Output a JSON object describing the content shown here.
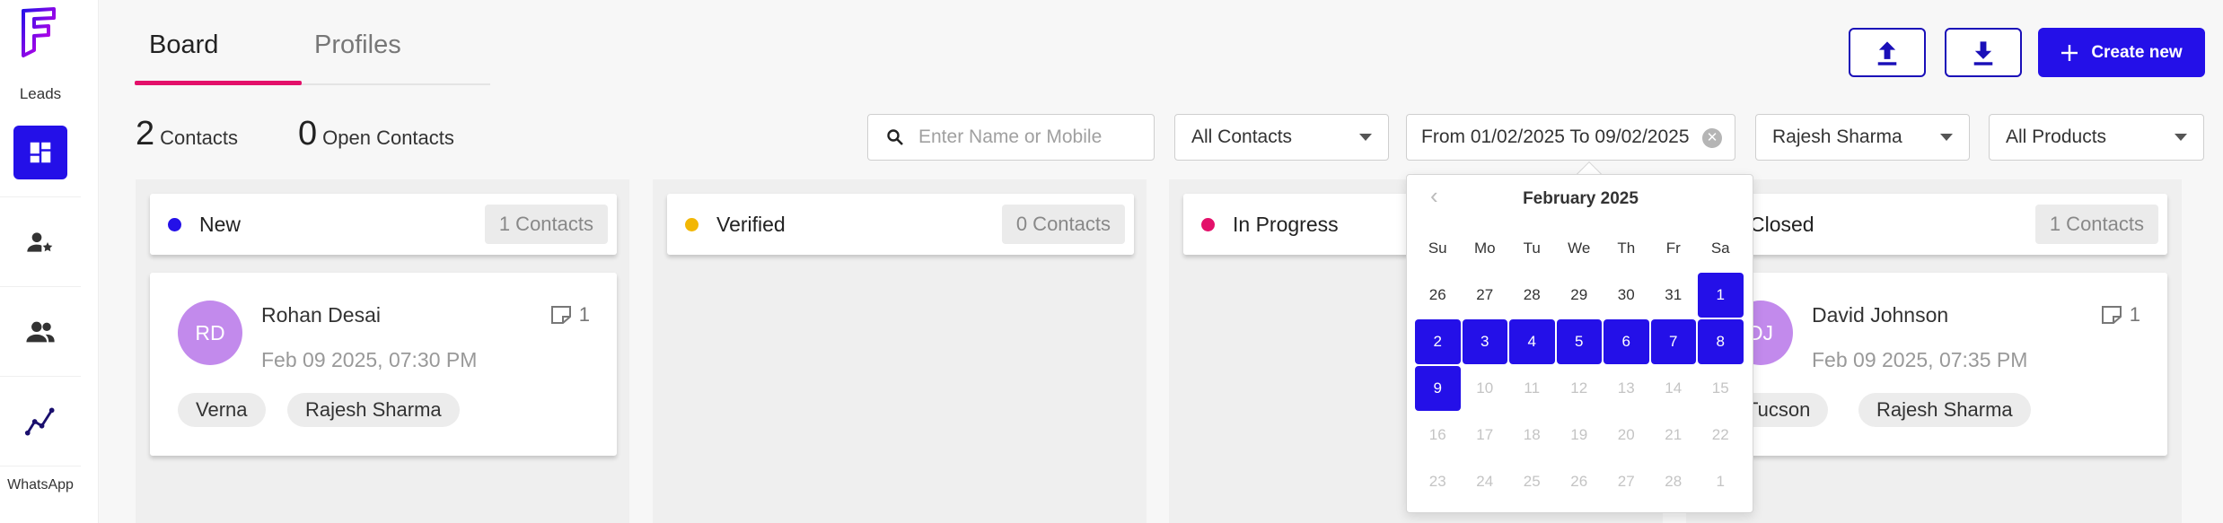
{
  "colors": {
    "accent": "#2410e8",
    "tab_underline": "#e3106a",
    "new_dot": "#2410e8",
    "verified_dot": "#f2b705",
    "in_progress_dot": "#e3106a",
    "avatar": "#c28aec"
  },
  "sidebar": {
    "label_top": "Leads",
    "items": [
      {
        "icon": "dashboard-icon"
      },
      {
        "icon": "user-star-icon"
      },
      {
        "icon": "people-icon"
      },
      {
        "icon": "analytics-icon"
      }
    ],
    "label_bottom": "WhatsApp"
  },
  "tabs": [
    {
      "label": "Board"
    },
    {
      "label": "Profiles"
    }
  ],
  "toolbar": {
    "upload_icon": "upload-icon",
    "download_icon": "download-icon",
    "create_label": "Create new"
  },
  "summary": {
    "contacts_num": "2",
    "contacts_label": "Contacts",
    "open_num": "0",
    "open_label": "Open Contacts"
  },
  "filters": {
    "search_placeholder": "Enter Name or Mobile",
    "contacts_select": "All Contacts",
    "date_range": "From 01/02/2025 To 09/02/2025",
    "user_select": "Rajesh Sharma",
    "products_select": "All Products"
  },
  "columns": [
    {
      "title": "New",
      "count": "1 Contacts",
      "card": {
        "initials": "RD",
        "name": "Rohan Desai",
        "date": "Feb 09 2025, 07:30 PM",
        "notes": "1",
        "tags": [
          "Verna",
          "Rajesh Sharma"
        ]
      }
    },
    {
      "title": "Verified",
      "count": "0 Contacts"
    },
    {
      "title": "In Progress"
    },
    {
      "title": "Closed",
      "count": "1 Contacts",
      "card": {
        "initials": "DJ",
        "name": "David Johnson",
        "date": "Feb 09 2025, 07:35 PM",
        "notes": "1",
        "tags": [
          "Tucson",
          "Rajesh Sharma"
        ]
      }
    }
  ],
  "calendar": {
    "month": "February 2025",
    "weekdays": [
      "Su",
      "Mo",
      "Tu",
      "We",
      "Th",
      "Fr",
      "Sa"
    ],
    "days": [
      {
        "d": "26",
        "s": "normal"
      },
      {
        "d": "27",
        "s": "normal"
      },
      {
        "d": "28",
        "s": "normal"
      },
      {
        "d": "29",
        "s": "normal"
      },
      {
        "d": "30",
        "s": "normal"
      },
      {
        "d": "31",
        "s": "normal"
      },
      {
        "d": "1",
        "s": "selected"
      },
      {
        "d": "2",
        "s": "selected"
      },
      {
        "d": "3",
        "s": "selected"
      },
      {
        "d": "4",
        "s": "selected"
      },
      {
        "d": "5",
        "s": "selected"
      },
      {
        "d": "6",
        "s": "selected"
      },
      {
        "d": "7",
        "s": "selected"
      },
      {
        "d": "8",
        "s": "selected"
      },
      {
        "d": "9",
        "s": "selected"
      },
      {
        "d": "10",
        "s": "disabled"
      },
      {
        "d": "11",
        "s": "disabled"
      },
      {
        "d": "12",
        "s": "disabled"
      },
      {
        "d": "13",
        "s": "disabled"
      },
      {
        "d": "14",
        "s": "disabled"
      },
      {
        "d": "15",
        "s": "disabled"
      },
      {
        "d": "16",
        "s": "disabled"
      },
      {
        "d": "17",
        "s": "disabled"
      },
      {
        "d": "18",
        "s": "disabled"
      },
      {
        "d": "19",
        "s": "disabled"
      },
      {
        "d": "20",
        "s": "disabled"
      },
      {
        "d": "21",
        "s": "disabled"
      },
      {
        "d": "22",
        "s": "disabled"
      },
      {
        "d": "23",
        "s": "disabled"
      },
      {
        "d": "24",
        "s": "disabled"
      },
      {
        "d": "25",
        "s": "disabled"
      },
      {
        "d": "26",
        "s": "disabled"
      },
      {
        "d": "27",
        "s": "disabled"
      },
      {
        "d": "28",
        "s": "disabled"
      },
      {
        "d": "1",
        "s": "disabled"
      }
    ]
  }
}
